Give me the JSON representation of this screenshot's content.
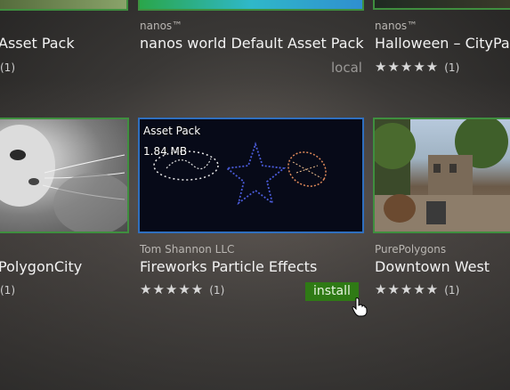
{
  "cards": {
    "top_left": {
      "title": "Asset Pack",
      "count": "(1)"
    },
    "top_mid": {
      "author": "nanos™",
      "title": "nanos world Default Asset Pack",
      "status": "local"
    },
    "top_right": {
      "author": "nanos™",
      "title": "Halloween – CityPar",
      "stars": "★★★★★",
      "count": "(1)"
    },
    "mid_left": {
      "title": "PolygonCity",
      "count": "(1)"
    },
    "mid_mid": {
      "badge": "Asset Pack",
      "size": "1.84 MB",
      "author": "Tom Shannon LLC",
      "title": "Fireworks Particle Effects",
      "stars": "★★★★★",
      "count": "(1)",
      "install_label": "install"
    },
    "mid_right": {
      "author": "PurePolygons",
      "title": "Downtown West",
      "stars": "★★★★★",
      "count": "(1)"
    }
  },
  "icons": {
    "cursor": "hand-pointer-icon",
    "star": "star-icon"
  },
  "colors": {
    "install": "#2f7a15",
    "selected_border": "#2f6fbf",
    "owned_border": "#3f8f3f"
  }
}
